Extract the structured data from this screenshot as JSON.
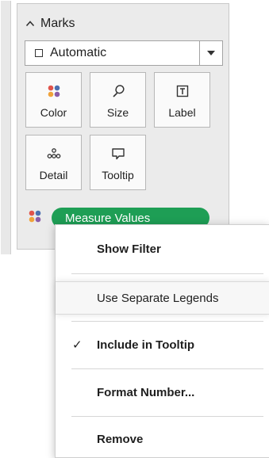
{
  "marks": {
    "header": "Marks",
    "mark_type": "Automatic",
    "buttons": [
      {
        "label": "Color",
        "icon": "color-dots-icon"
      },
      {
        "label": "Size",
        "icon": "size-icon"
      },
      {
        "label": "Label",
        "icon": "label-icon"
      },
      {
        "label": "Detail",
        "icon": "detail-icon"
      },
      {
        "label": "Tooltip",
        "icon": "tooltip-icon"
      }
    ],
    "pill": {
      "label": "Measure Values",
      "color": "#1e9e55",
      "icon": "color-dots-icon"
    }
  },
  "menu": {
    "items": [
      {
        "label": "Show Filter",
        "checked": false,
        "bold": true,
        "highlighted": false
      },
      {
        "label": "Use Separate Legends",
        "checked": false,
        "bold": false,
        "highlighted": true
      },
      {
        "label": "Include in Tooltip",
        "checked": true,
        "bold": true,
        "highlighted": false
      },
      {
        "label": "Format Number...",
        "checked": false,
        "bold": true,
        "highlighted": false
      },
      {
        "label": "Remove",
        "checked": false,
        "bold": true,
        "highlighted": false
      }
    ],
    "check_glyph": "✓"
  }
}
